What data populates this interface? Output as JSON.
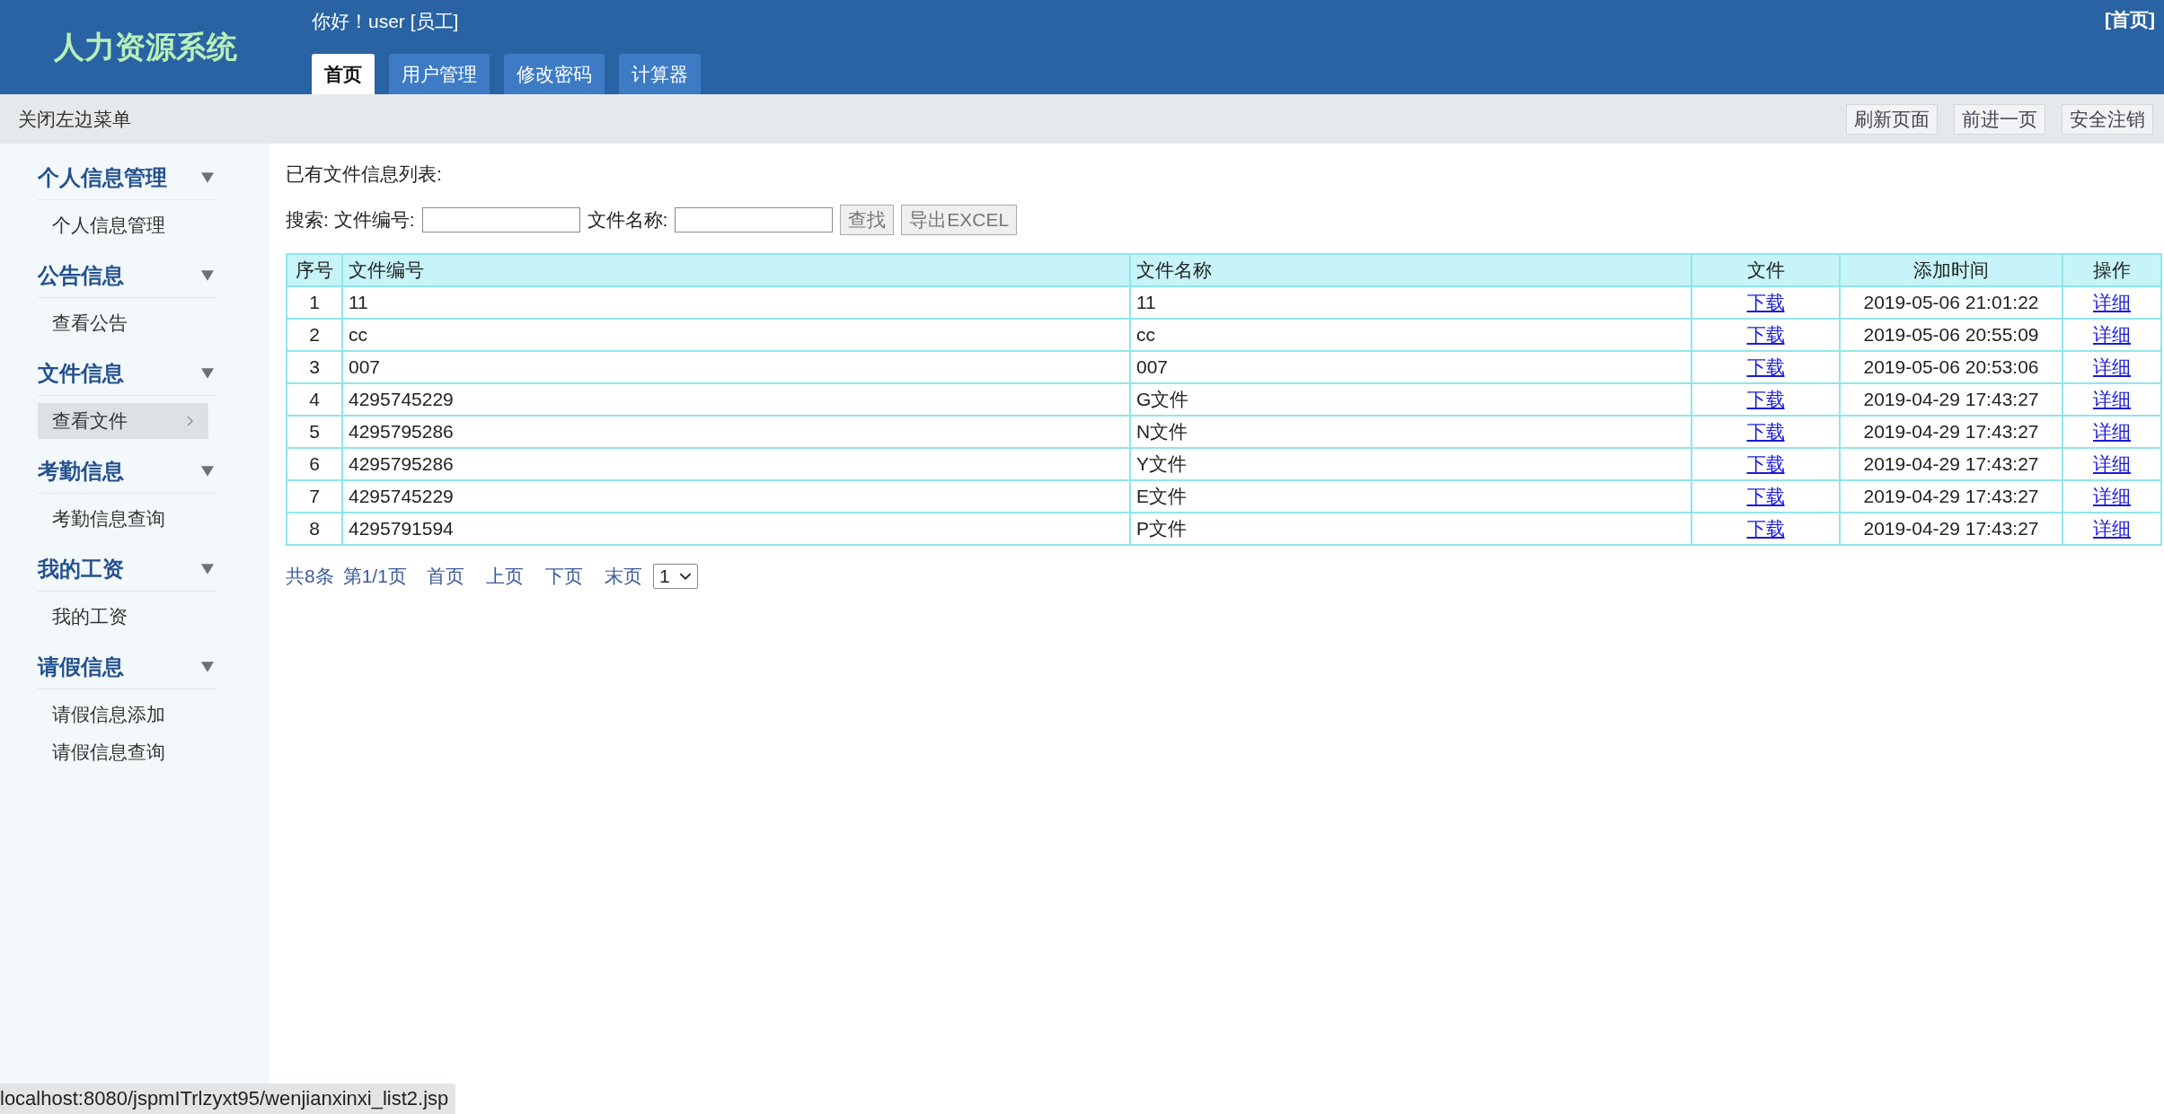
{
  "header": {
    "logo": "人力资源系统",
    "greeting": "你好！user [员工]",
    "home_link": "[首页]",
    "tabs": [
      {
        "label": "首页",
        "selected": true
      },
      {
        "label": "用户管理",
        "selected": false
      },
      {
        "label": "修改密码",
        "selected": false
      },
      {
        "label": "计算器",
        "selected": false
      }
    ]
  },
  "toolbar": {
    "toggle_menu": "关闭左边菜单",
    "buttons": [
      "刷新页面",
      "前进一页",
      "安全注销"
    ]
  },
  "sidebar": {
    "groups": [
      {
        "title": "个人信息管理",
        "items": [
          {
            "label": "个人信息管理",
            "selected": false
          }
        ]
      },
      {
        "title": "公告信息",
        "items": [
          {
            "label": "查看公告",
            "selected": false
          }
        ]
      },
      {
        "title": "文件信息",
        "items": [
          {
            "label": "查看文件",
            "selected": true
          }
        ]
      },
      {
        "title": "考勤信息",
        "items": [
          {
            "label": "考勤信息查询",
            "selected": false
          }
        ]
      },
      {
        "title": "我的工资",
        "items": [
          {
            "label": "我的工资",
            "selected": false
          }
        ]
      },
      {
        "title": "请假信息",
        "items": [
          {
            "label": "请假信息添加",
            "selected": false
          },
          {
            "label": "请假信息查询",
            "selected": false
          }
        ]
      }
    ]
  },
  "content": {
    "heading": "已有文件信息列表:",
    "search": {
      "label": "搜索: 文件编号:",
      "second_label": "文件名称:",
      "buttons": [
        "查找",
        "导出EXCEL"
      ]
    },
    "table": {
      "columns": [
        "序号",
        "文件编号",
        "文件名称",
        "文件",
        "添加时间",
        "操作"
      ],
      "rows": [
        [
          "1",
          "11",
          "11",
          "下载",
          "2019-05-06 21:01:22",
          "详细"
        ],
        [
          "2",
          "cc",
          "cc",
          "下载",
          "2019-05-06 20:55:09",
          "详细"
        ],
        [
          "3",
          "007",
          "007",
          "下载",
          "2019-05-06 20:53:06",
          "详细"
        ],
        [
          "4",
          "4295745229",
          "G文件",
          "下载",
          "2019-04-29 17:43:27",
          "详细"
        ],
        [
          "5",
          "4295795286",
          "N文件",
          "下载",
          "2019-04-29 17:43:27",
          "详细"
        ],
        [
          "6",
          "4295795286",
          "Y文件",
          "下载",
          "2019-04-29 17:43:27",
          "详细"
        ],
        [
          "7",
          "4295745229",
          "E文件",
          "下载",
          "2019-04-29 17:43:27",
          "详细"
        ],
        [
          "8",
          "4295791594",
          "P文件",
          "下载",
          "2019-04-29 17:43:27",
          "详细"
        ]
      ]
    },
    "pagination": {
      "total": "共8条",
      "page": "第1/1页",
      "links": [
        "首页",
        "上页",
        "下页",
        "末页"
      ],
      "select_value": "1"
    }
  },
  "status_bar": "localhost:8080/jspmITrlzyxt95/wenjianxinxi_list2.jsp"
}
